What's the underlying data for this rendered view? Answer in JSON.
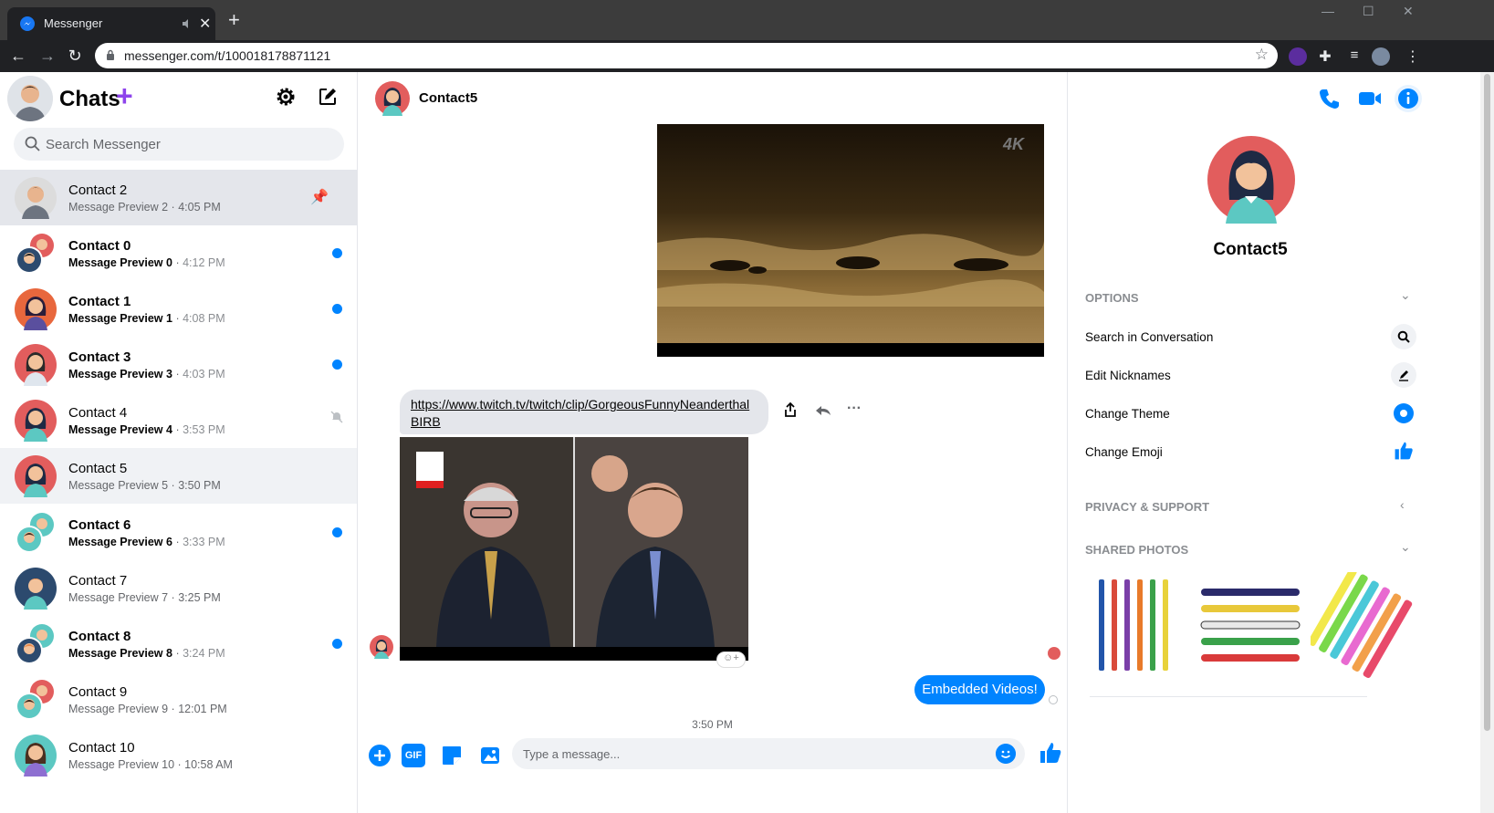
{
  "browser": {
    "tab_title": "Messenger",
    "new_tab": "+",
    "url": "messenger.com/t/100018178871121"
  },
  "sidebar": {
    "title": "Chats",
    "plus_glyph": "+",
    "search_placeholder": "Search Messenger",
    "conversations": [
      {
        "name": "Contact 2",
        "preview": "Message Preview 2",
        "time": "4:05 PM",
        "unread": false,
        "pinned": true
      },
      {
        "name": "Contact 0",
        "preview": "Message Preview 0",
        "time": "4:12 PM",
        "unread": true
      },
      {
        "name": "Contact 1",
        "preview": "Message Preview 1",
        "time": "4:08 PM",
        "unread": true
      },
      {
        "name": "Contact 3",
        "preview": "Message Preview 3",
        "time": "4:03 PM",
        "unread": true
      },
      {
        "name": "Contact 4",
        "preview": "Message Preview 4",
        "time": "3:53 PM",
        "unread": false,
        "muted": true
      },
      {
        "name": "Contact 5",
        "preview": "Message Preview 5",
        "time": "3:50 PM",
        "unread": false
      },
      {
        "name": "Contact 6",
        "preview": "Message Preview 6",
        "time": "3:33 PM",
        "unread": true
      },
      {
        "name": "Contact 7",
        "preview": "Message Preview 7",
        "time": "3:25 PM",
        "unread": false
      },
      {
        "name": "Contact 8",
        "preview": "Message Preview 8",
        "time": "3:24 PM",
        "unread": true
      },
      {
        "name": "Contact 9",
        "preview": "Message Preview 9",
        "time": "12:01 PM",
        "unread": false
      },
      {
        "name": "Contact 10",
        "preview": "Message Preview 10",
        "time": "10:58 AM",
        "unread": false
      }
    ]
  },
  "chat": {
    "contact_name": "Contact5",
    "video1_badge": "4K",
    "link_text": "https://www.twitch.tv/twitch/clip/GorgeousFunnyNeanderthalBIRB",
    "outgoing_message": "Embedded Videos!",
    "timestamp": "3:50 PM",
    "composer_placeholder": "Type a message...",
    "gif_label": "GIF"
  },
  "info": {
    "name": "Contact5",
    "options_title": "OPTIONS",
    "options": [
      "Search in Conversation",
      "Edit Nicknames",
      "Change Theme",
      "Change Emoji"
    ],
    "privacy_title": "PRIVACY & SUPPORT",
    "photos_title": "SHARED PHOTOS"
  },
  "colors": {
    "accent": "#0084ff",
    "plus": "#8e44ec",
    "avatar_red": "#e25d5d",
    "avatar_teal": "#5cc8c2",
    "avatar_navy": "#2c4a6e"
  },
  "icons": [
    "settings-icon",
    "compose-icon",
    "search-icon",
    "pin-icon",
    "mute-icon",
    "phone-icon",
    "video-call-icon",
    "info-icon",
    "share-icon",
    "reply-icon",
    "more-icon",
    "plus-icon",
    "gif-icon",
    "sticker-icon",
    "image-icon",
    "emoji-icon",
    "like-icon"
  ]
}
